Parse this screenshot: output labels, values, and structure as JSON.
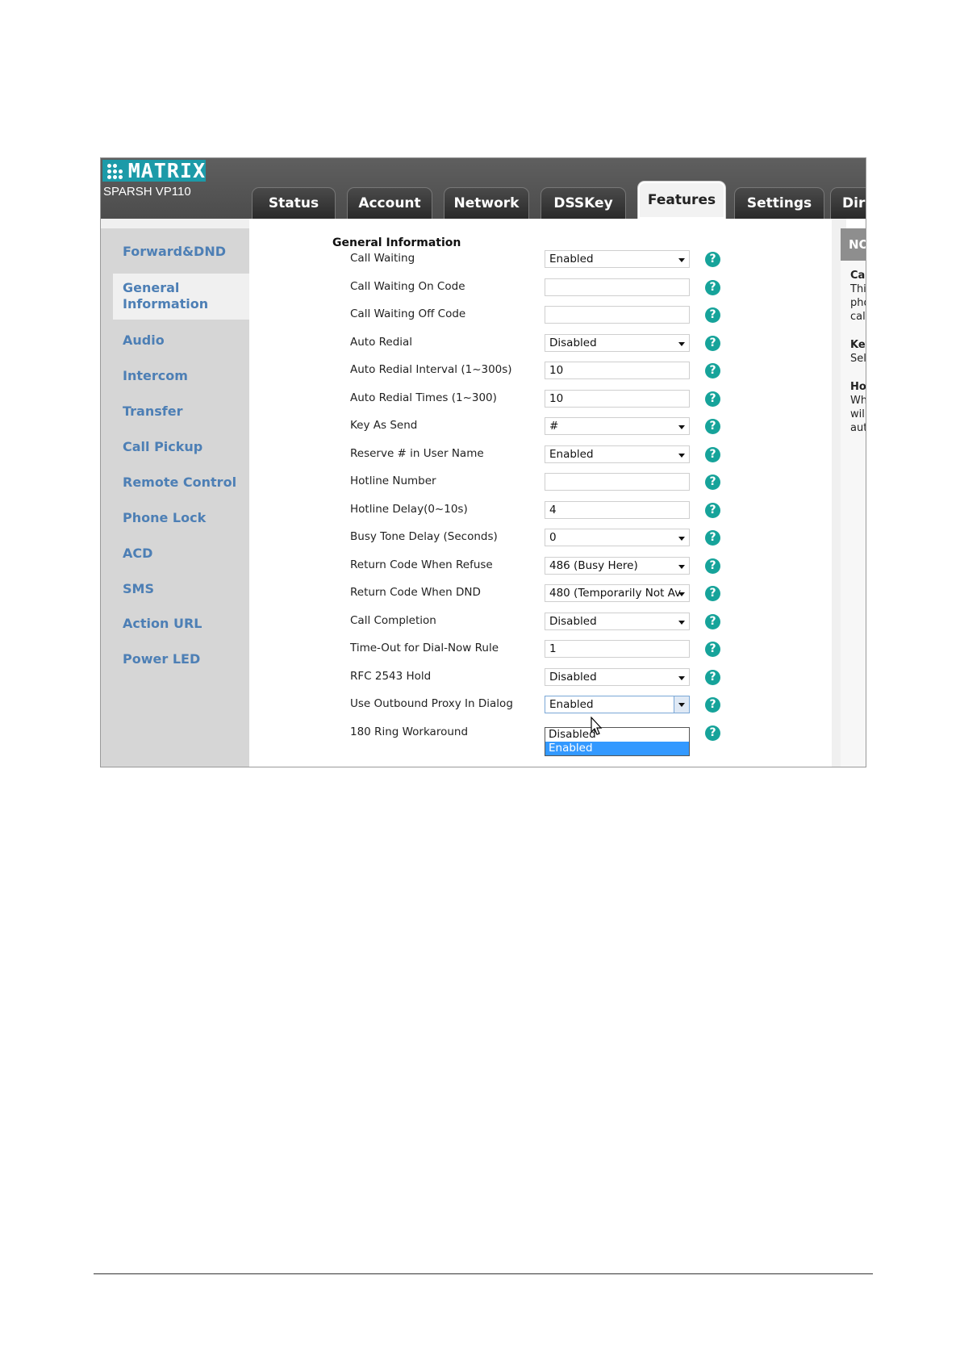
{
  "brand": {
    "logo_text": "MATRIX",
    "model": "SPARSH VP110",
    "accent": "#1c9aa8"
  },
  "tabs": [
    {
      "label": "Status"
    },
    {
      "label": "Account"
    },
    {
      "label": "Network"
    },
    {
      "label": "DSSKey"
    },
    {
      "label": "Features",
      "active": true
    },
    {
      "label": "Settings"
    },
    {
      "label": "Dire"
    }
  ],
  "sidebar": {
    "items": [
      {
        "label": "Forward&DND"
      },
      {
        "label": "General Information",
        "line1": "General",
        "line2": "Information",
        "active": true
      },
      {
        "label": "Audio"
      },
      {
        "label": "Intercom"
      },
      {
        "label": "Transfer"
      },
      {
        "label": "Call Pickup"
      },
      {
        "label": "Remote Control"
      },
      {
        "label": "Phone Lock"
      },
      {
        "label": "ACD"
      },
      {
        "label": "SMS"
      },
      {
        "label": "Action URL"
      },
      {
        "label": "Power LED"
      }
    ]
  },
  "section": {
    "title": "General Information"
  },
  "rows": [
    {
      "label": "Call Waiting",
      "type": "select",
      "value": "Enabled"
    },
    {
      "label": "Call Waiting On Code",
      "type": "text",
      "value": ""
    },
    {
      "label": "Call Waiting Off Code",
      "type": "text",
      "value": ""
    },
    {
      "label": "Auto Redial",
      "type": "select",
      "value": "Disabled"
    },
    {
      "label": "Auto Redial Interval (1~300s)",
      "type": "text",
      "value": "10"
    },
    {
      "label": "Auto Redial Times (1~300)",
      "type": "text",
      "value": "10"
    },
    {
      "label": "Key As Send",
      "type": "select",
      "value": "#"
    },
    {
      "label": "Reserve # in User Name",
      "type": "select",
      "value": "Enabled"
    },
    {
      "label": "Hotline Number",
      "type": "text",
      "value": ""
    },
    {
      "label": "Hotline Delay(0~10s)",
      "type": "text",
      "value": "4"
    },
    {
      "label": "Busy Tone Delay (Seconds)",
      "type": "select",
      "value": "0"
    },
    {
      "label": "Return Code When Refuse",
      "type": "select",
      "value": "486 (Busy Here)"
    },
    {
      "label": "Return Code When DND",
      "type": "select",
      "value": "480 (Temporarily Not Av"
    },
    {
      "label": "Call Completion",
      "type": "select",
      "value": "Disabled"
    },
    {
      "label": "Time-Out for Dial-Now Rule",
      "type": "text",
      "value": "1"
    },
    {
      "label": "RFC 2543 Hold",
      "type": "select",
      "value": "Disabled"
    },
    {
      "label": "Use Outbound Proxy In Dialog",
      "type": "select",
      "value": "Enabled",
      "focused": true
    },
    {
      "label": "180 Ring Workaround",
      "type": "select",
      "value": ""
    }
  ],
  "help_icon": {
    "glyph": "?",
    "color": "#16a39a",
    "name": "help-icon"
  },
  "dropdown": {
    "options": [
      {
        "label": "Disabled",
        "selected": false
      },
      {
        "label": "Enabled",
        "selected": true
      }
    ]
  },
  "notes": {
    "header": "NO",
    "lines": [
      {
        "text": "Cal",
        "bold": true
      },
      {
        "text": "Thi",
        "bold": false
      },
      {
        "text": "pho",
        "bold": false
      },
      {
        "text": "call",
        "bold": false
      },
      {
        "text": "Key",
        "bold": true
      },
      {
        "text": "Sel",
        "bold": false
      },
      {
        "text": "Hot",
        "bold": true
      },
      {
        "text": "Wh",
        "bold": false
      },
      {
        "text": "will",
        "bold": false
      },
      {
        "text": "aut",
        "bold": false
      }
    ]
  }
}
